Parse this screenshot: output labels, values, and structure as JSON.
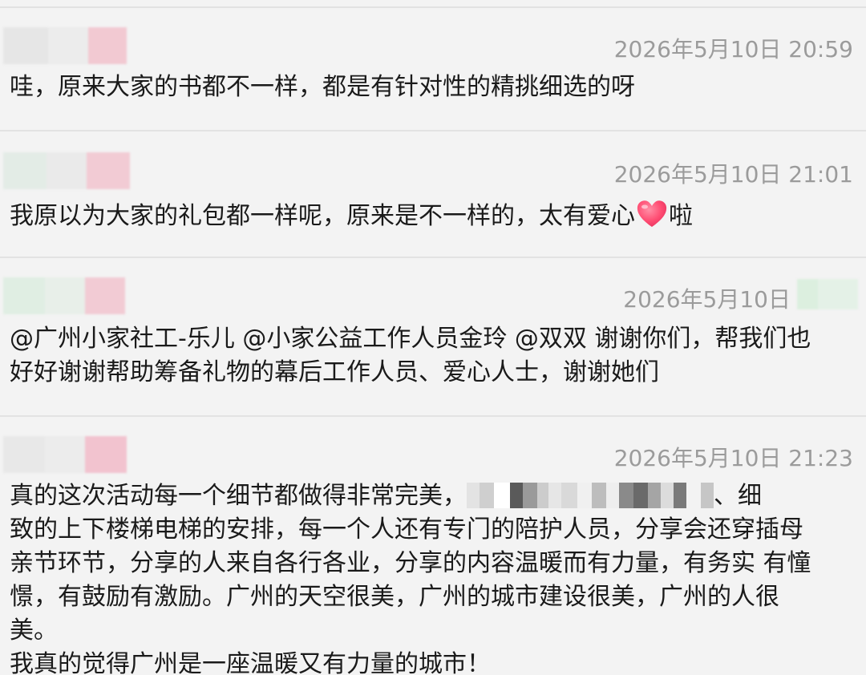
{
  "comments": [
    {
      "timestamp": "2026年5月10日 20:59",
      "text": "哇，原来大家的书都不一样，都是有针对性的精挑细选的呀"
    },
    {
      "timestamp": "2026年5月10日 21:01",
      "text_before": "我原以为大家的礼包都一样呢，原来是不一样的，太有爱心",
      "emoji": "heart-emoji",
      "text_after": "啦"
    },
    {
      "timestamp": "2026年5月10日",
      "text_line1": "@广州小家社工-乐儿 @小家公益工作人员金玲 @双双 谢谢你们，帮我们也",
      "text_line2": "好好谢谢帮助筹备礼物的幕后工作人员、爱心人士，谢谢她们"
    },
    {
      "timestamp": "2026年5月10日 21:23",
      "line1_start": "真的这次活动每一个细节都做得非常完美，",
      "line1_end": "、细",
      "line2": "致的上下楼梯电梯的安排，每一个人还有专门的陪护人员，分享会还穿插母",
      "line3": "亲节环节，分享的人来自各行各业，分享的内容温暖而有力量，有务实 有憧",
      "line4": "憬，有鼓励有激励。广州的天空很美，广州的城市建设很美，广州的人很",
      "line5": "美。",
      "line6": "我真的觉得广州是一座温暖又有力量的城市！"
    }
  ],
  "colors": {
    "background": "#f3f3f3",
    "timestamp": "#9b9b9b",
    "text": "#1a1a1a",
    "divider": "#e2e2e2"
  }
}
